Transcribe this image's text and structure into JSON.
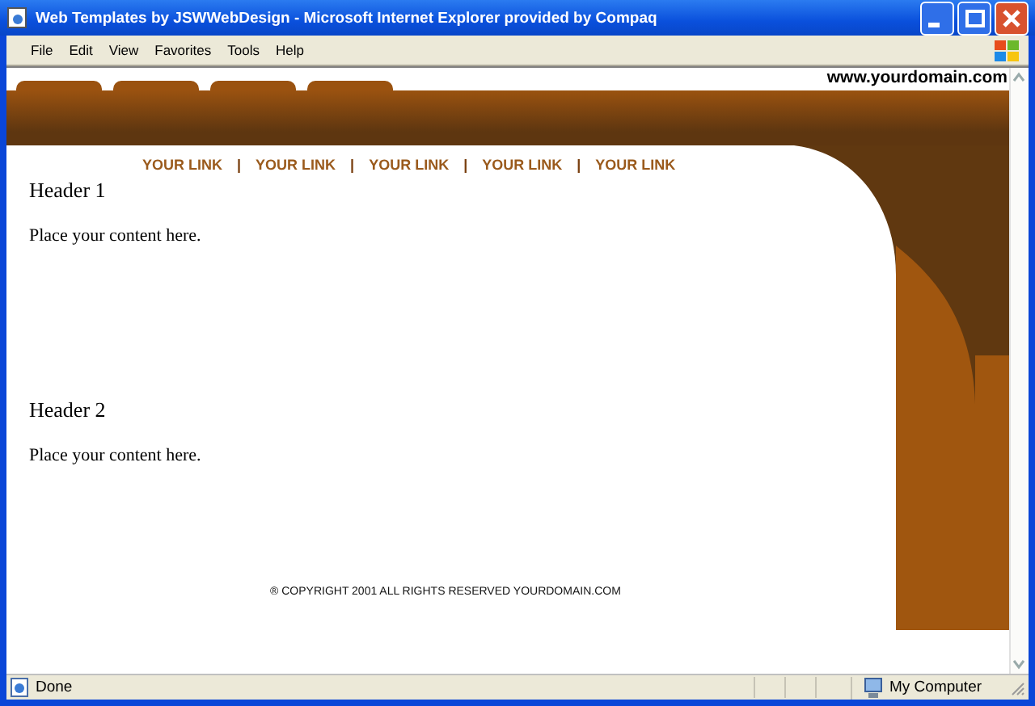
{
  "window": {
    "title": "Web Templates by JSWWebDesign - Microsoft Internet Explorer provided by Compaq"
  },
  "menu": [
    "File",
    "Edit",
    "View",
    "Favorites",
    "Tools",
    "Help"
  ],
  "page": {
    "domain": "www.yourdomain.com",
    "nav_links": [
      "YOUR LINK",
      "YOUR LINK",
      "YOUR LINK",
      "YOUR LINK",
      "YOUR LINK"
    ],
    "separators": [
      "|",
      "|",
      "|",
      "|"
    ],
    "sections": [
      {
        "header": "Header 1",
        "body": "Place your content here."
      },
      {
        "header": "Header 2",
        "body": "Place your content here."
      }
    ],
    "copyright": "® COPYRIGHT 2001 ALL RIGHTS RESERVED YOURDOMAIN.COM"
  },
  "status_bar": {
    "text": "Done",
    "zone": "My Computer"
  }
}
